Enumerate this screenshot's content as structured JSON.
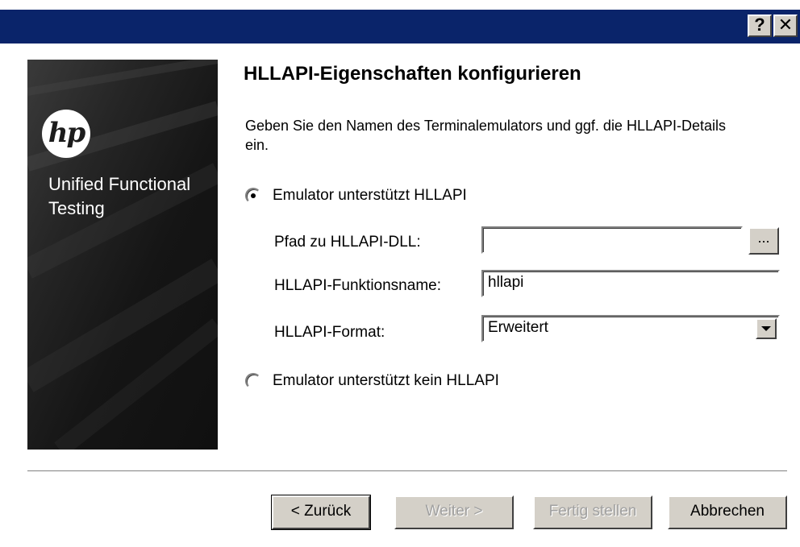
{
  "window": {
    "title": "",
    "help_button_label": "?",
    "close_button_label": "✕"
  },
  "banner": {
    "logo_text": "hp",
    "product_name": "Unified Functional Testing"
  },
  "page": {
    "heading": "HLLAPI-Eigenschaften konfigurieren",
    "description": "Geben Sie den Namen des Terminalemulators und ggf. die HLLAPI-Details ein."
  },
  "options": {
    "supports_hllapi": {
      "label": "Emulator unterstützt HLLAPI",
      "selected": true
    },
    "no_hllapi": {
      "label": "Emulator unterstützt kein HLLAPI",
      "selected": false
    }
  },
  "fields": {
    "dll_path": {
      "label": "Pfad zu HLLAPI-DLL:",
      "value": "",
      "browse_label": "..."
    },
    "function_name": {
      "label": "HLLAPI-Funktionsname:",
      "value": "hllapi"
    },
    "format": {
      "label": "HLLAPI-Format:",
      "value": "Erweitert"
    }
  },
  "buttons": {
    "back": {
      "label": "< Zurück",
      "enabled": true
    },
    "next": {
      "label": "Weiter >",
      "enabled": false
    },
    "finish": {
      "label": "Fertig stellen",
      "enabled": false
    },
    "cancel": {
      "label": "Abbrechen",
      "enabled": true
    }
  }
}
